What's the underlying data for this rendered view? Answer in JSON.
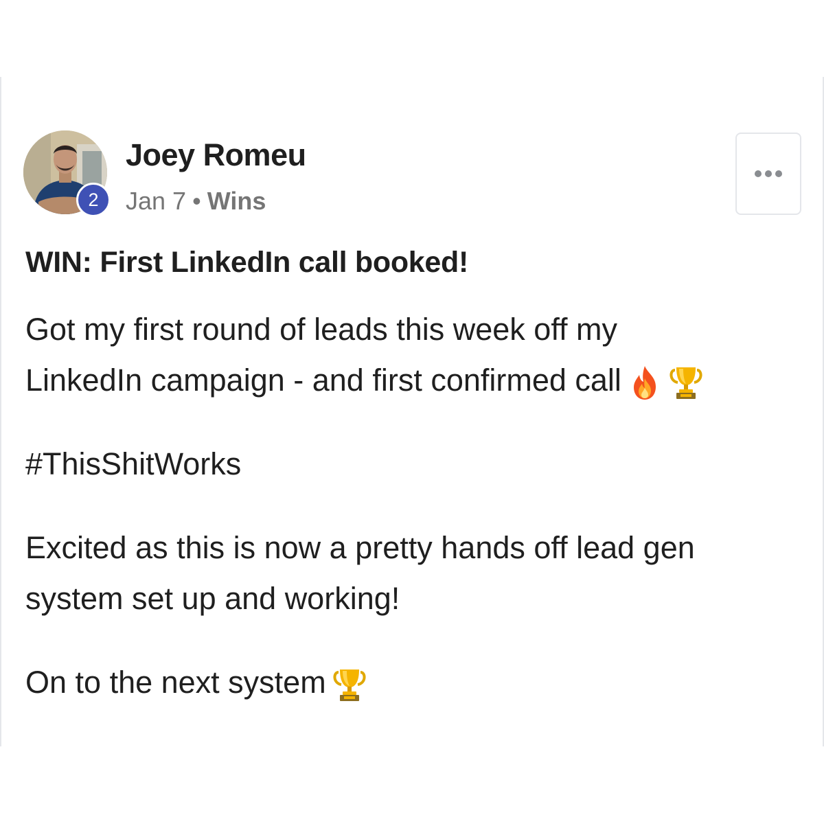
{
  "post": {
    "author": {
      "name": "Joey Romeu",
      "level": "2",
      "avatar_icon": "avatar-photo"
    },
    "meta": {
      "date": "Jan 7",
      "separator": "•",
      "category": "Wins"
    },
    "menu_icon": "more-options-icon",
    "title": "WIN: First LinkedIn call booked!",
    "body": {
      "line1": "Got my first round of leads this week off my",
      "line2": "LinkedIn campaign - and first confirmed call",
      "line2_emojis": [
        "fire-emoji",
        "trophy-emoji"
      ],
      "hashtag": "#ThisShitWorks",
      "line3": "Excited as this is now a pretty hands off lead gen",
      "line4": "system set up and working!",
      "line5": "On to the next system",
      "line5_emojis": [
        "trophy-emoji"
      ]
    }
  },
  "colors": {
    "level_badge": "#3f51b5",
    "meta_text": "#757575",
    "border": "#e4e6ea"
  }
}
